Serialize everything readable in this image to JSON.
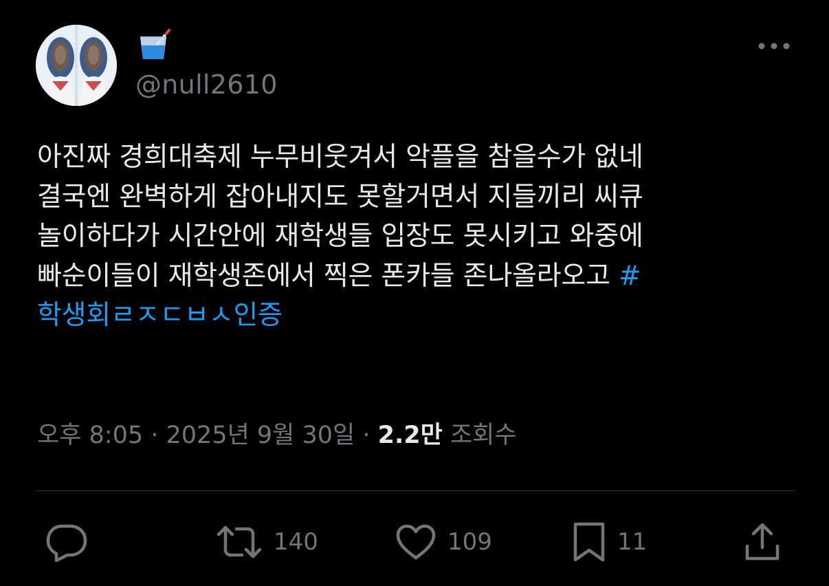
{
  "user": {
    "display_name": "🥤",
    "handle": "@null2610"
  },
  "tweet": {
    "lines": [
      "아진짜 경희대축제 누무비웃겨서 악플을 참을수가 없네",
      "결국엔 완벽하게 잡아내지도 못할거면서 지들끼리 씨큐",
      "놀이하다가 시간안에 재학생들 입장도 못시키고 와중에",
      "빠순이들이 재학생존에서 찍은 폰카들 존나올라오고 "
    ],
    "hashtag_part1": "#",
    "hashtag_part2": "학생회ㄹㅈㄷㅂㅅ인증"
  },
  "meta": {
    "time": "오후 8:05",
    "separator": " · ",
    "date": "2025년 9월 30일",
    "views_count": "2.2만",
    "views_label": " 조회수"
  },
  "actions": {
    "reply_icon": "reply-icon",
    "retweet_icon": "retweet-icon",
    "retweet_count": "140",
    "like_icon": "heart-icon",
    "like_count": "109",
    "bookmark_icon": "bookmark-icon",
    "bookmark_count": "11",
    "share_icon": "share-icon"
  },
  "colors": {
    "background": "#000000",
    "text": "#e7e9ea",
    "secondary": "#71767b",
    "accent": "#1d9bf0",
    "divider": "#2f3336"
  }
}
